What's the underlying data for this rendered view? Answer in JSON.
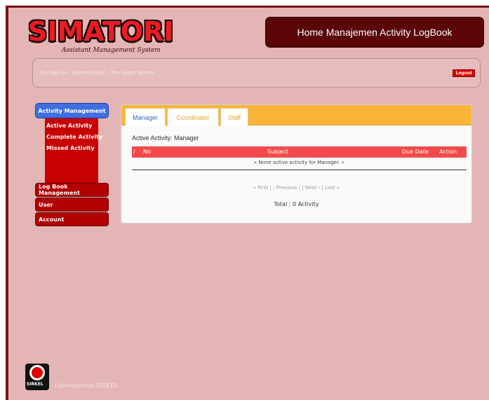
{
  "header": {
    "logo_word": "SIMATORI",
    "logo_subtitle": "Assistant Management System",
    "title": "Home Manajemen Activity LogBook"
  },
  "login": {
    "text": "You login as : Administrator - The Super Admin-",
    "logout": "Logout"
  },
  "sidebar": {
    "header": "Activity Management",
    "sub_items": [
      "Active Activity",
      "Complete Activity",
      "Missed Activity"
    ],
    "items": [
      "Log Book Management",
      "User",
      "Account"
    ]
  },
  "tabs": [
    "Manager",
    "Coordinator",
    "Staff"
  ],
  "main": {
    "active_label": "Active Activity: Manager",
    "columns": [
      "/",
      "No",
      "Subject",
      "Due Date",
      "Action"
    ],
    "empty_message": "« None active activity for Manager. »",
    "pager": "« First | ‹ Previous | | Next › | Last »",
    "total": "Total : 0 Activity"
  },
  "footer": {
    "logo_text": "SIRKEL",
    "text": "Laboratorium SIRKEL"
  },
  "colors": {
    "background": "#e3b6b5",
    "title_box": "#5b0606",
    "tab_bar": "#f9b43a",
    "table_header": "#f24a4a",
    "sidebar_active": "#3f6fe0",
    "sidebar_item": "#b00000"
  }
}
